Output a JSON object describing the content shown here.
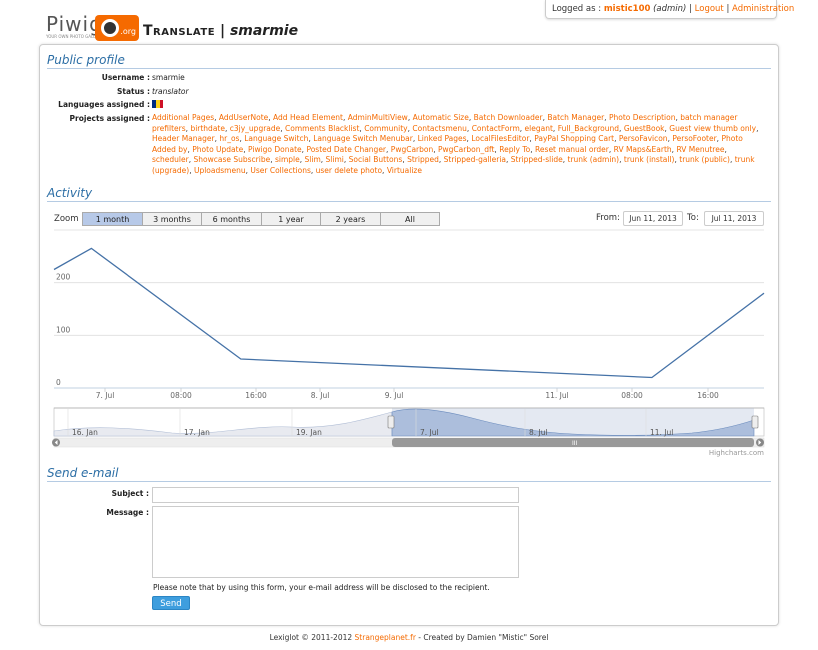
{
  "header": {
    "logged_as_prefix": "Logged as :",
    "username": "mistic100",
    "role": "(admin)",
    "sep": "|",
    "logout": "Logout",
    "administration": "Administration"
  },
  "logo": {
    "word": "Piwigo",
    "org": ".org",
    "tagline": "YOUR OWN PHOTO GALLERY"
  },
  "page_title": {
    "part1": "Translate",
    "sep": "|",
    "user": "smarmie"
  },
  "profile": {
    "title": "Public profile",
    "username_label": "Username :",
    "username": "smarmie",
    "status_label": "Status :",
    "status": "translator",
    "languages_label": "Languages assigned :",
    "projects_label": "Projects assigned :",
    "projects": [
      "Additional Pages",
      "AddUserNote",
      "Add Head Element",
      "AdminMultiView",
      "Automatic Size",
      "Batch Downloader",
      "Batch Manager",
      "Photo Description",
      "batch manager prefilters",
      "birthdate",
      "c3jy_upgrade",
      "Comments Blacklist",
      "Community",
      "Contactsmenu",
      "ContactForm",
      "elegant",
      "Full_Background",
      "GuestBook",
      "Guest view thumb only",
      "Header Manager",
      "hr_os",
      "Language Switch",
      "Language Switch Menubar",
      "Linked Pages",
      "LocalFilesEditor",
      "PayPal Shopping Cart",
      "PersoFavicon",
      "PersoFooter",
      "Photo Added by",
      "Photo Update",
      "Piwigo Donate",
      "Posted Date Changer",
      "PwgCarbon",
      "PwgCarbon_dft",
      "Reply To",
      "Reset manual order",
      "RV Maps&Earth",
      "RV Menutree",
      "scheduler",
      "Showcase Subscribe",
      "simple",
      "Slim",
      "Slimi",
      "Social Buttons",
      "Stripped",
      "Stripped-galleria",
      "Stripped-slide",
      "trunk (admin)",
      "trunk (install)",
      "trunk (public)",
      "trunk (upgrade)",
      "Uploadsmenu",
      "User Collections",
      "user delete photo",
      "Virtualize"
    ]
  },
  "activity": {
    "title": "Activity",
    "zoom_label": "Zoom",
    "zoom_buttons": [
      "1 month",
      "3 months",
      "6 months",
      "1 year",
      "2 years",
      "All"
    ],
    "active_zoom": "1 month",
    "from_label": "From:",
    "from": "Jun 11, 2013",
    "to_label": "To:",
    "to": "Jul 11, 2013",
    "credit": "Highcharts.com",
    "navigator_labels": [
      "16. Jan",
      "17. Jan",
      "19. Jan",
      "7. Jul",
      "8. Jul",
      "11. Jul"
    ]
  },
  "chart_data": {
    "type": "line",
    "series": [
      {
        "x": [
          "2013-07-06 18:00",
          "2013-07-07 00:00",
          "2013-07-08 00:00",
          "2013-07-10 18:00",
          "2013-07-11 12:00"
        ],
        "values": [
          225,
          265,
          55,
          20,
          180
        ]
      }
    ],
    "x_tick_labels": [
      "7. Jul",
      "08:00",
      "16:00",
      "8. Jul",
      "9. Jul",
      "11. Jul",
      "08:00",
      "16:00"
    ],
    "y_tick_labels": [
      "0",
      "100",
      "200"
    ],
    "ylim": [
      0,
      300
    ],
    "color": "#4572a7"
  },
  "email": {
    "title": "Send e-mail",
    "subject_label": "Subject :",
    "message_label": "Message :",
    "notice": "Please note that by using this form, your e-mail address will be disclosed to the recipient.",
    "send": "Send"
  },
  "footer": {
    "prefix": "Lexiglot © 2011-2012",
    "link": "Strangeplanet.fr",
    "suffix": "- Created by Damien \"Mistic\" Sorel"
  }
}
